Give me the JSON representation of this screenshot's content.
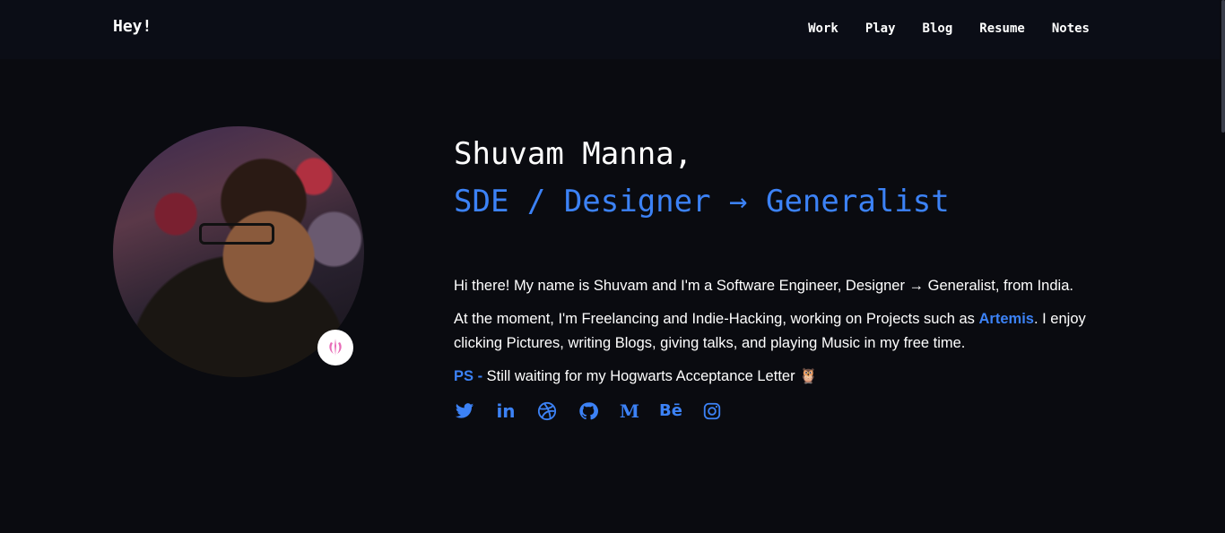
{
  "nav": {
    "brand": "Hey!",
    "links": [
      "Work",
      "Play",
      "Blog",
      "Resume",
      "Notes"
    ]
  },
  "hero": {
    "name": "Shuvam Manna,",
    "role": "SDE / Designer → Generalist"
  },
  "bio": {
    "line1": "Hi there! My name is Shuvam and I'm a Software Engineer, Designer → Generalist, from India.",
    "line2_before": "At the moment, I'm Freelancing and Indie-Hacking, working on Projects such as ",
    "line2_link": "Artemis",
    "line2_after": ". I enjoy clicking Pictures, writing Blogs, giving talks, and playing Music in my free time.",
    "ps_label": "PS -",
    "ps_text": " Still waiting for my Hogwarts Acceptance Letter 🦉"
  },
  "socials": [
    {
      "name": "twitter-icon"
    },
    {
      "name": "linkedin-icon",
      "label": "in"
    },
    {
      "name": "dribbble-icon"
    },
    {
      "name": "github-icon"
    },
    {
      "name": "medium-icon",
      "label": "M"
    },
    {
      "name": "behance-icon",
      "label": "Bē"
    },
    {
      "name": "instagram-icon"
    }
  ],
  "colors": {
    "background": "#0a0b10",
    "navbar": "#0b0d16",
    "accent": "#3c82f6",
    "text": "#ffffff"
  }
}
